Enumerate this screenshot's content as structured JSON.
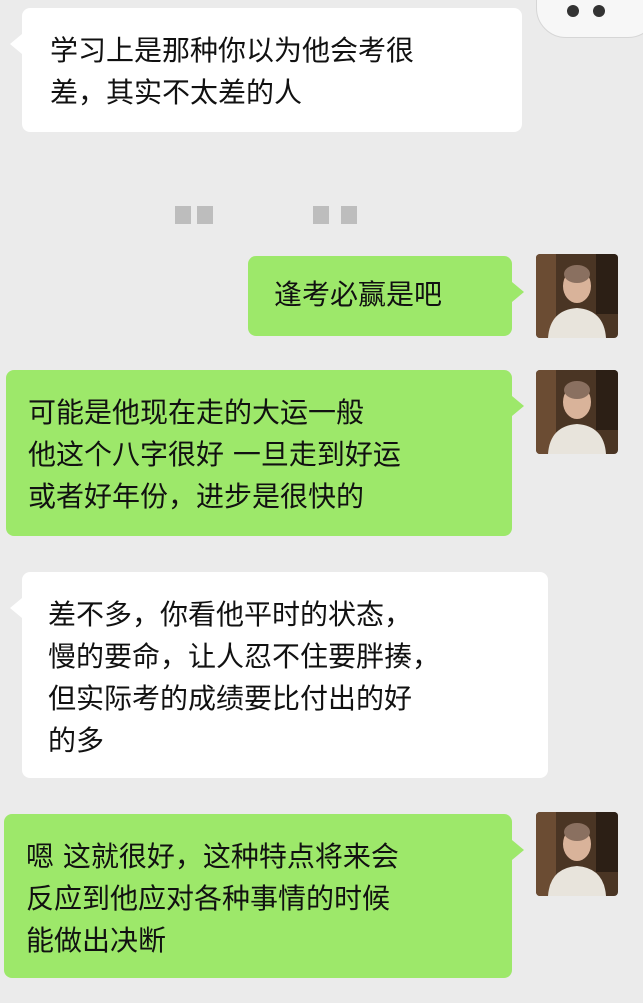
{
  "messages": [
    {
      "side": "in",
      "lines": [
        "学习上是那种你以为他会考很",
        "差，其实不太差的人"
      ]
    },
    {
      "side": "out",
      "lines": [
        "逢考必赢是吧"
      ]
    },
    {
      "side": "out",
      "lines": [
        "可能是他现在走的大运一般",
        "他这个八字很好 一旦走到好运",
        "或者好年份，进步是很快的"
      ]
    },
    {
      "side": "in",
      "lines": [
        "差不多，你看他平时的状态，",
        "慢的要命，让人忍不住要胖揍，",
        "但实际考的成绩要比付出的好",
        "的多"
      ]
    },
    {
      "side": "out",
      "lines": [
        "嗯 这就很好，这种特点将来会",
        "反应到他应对各种事情的时候",
        "能做出决断"
      ]
    }
  ],
  "colors": {
    "background": "#ebebeb",
    "incoming_bubble": "#ffffff",
    "outgoing_bubble": "#9de86a"
  }
}
